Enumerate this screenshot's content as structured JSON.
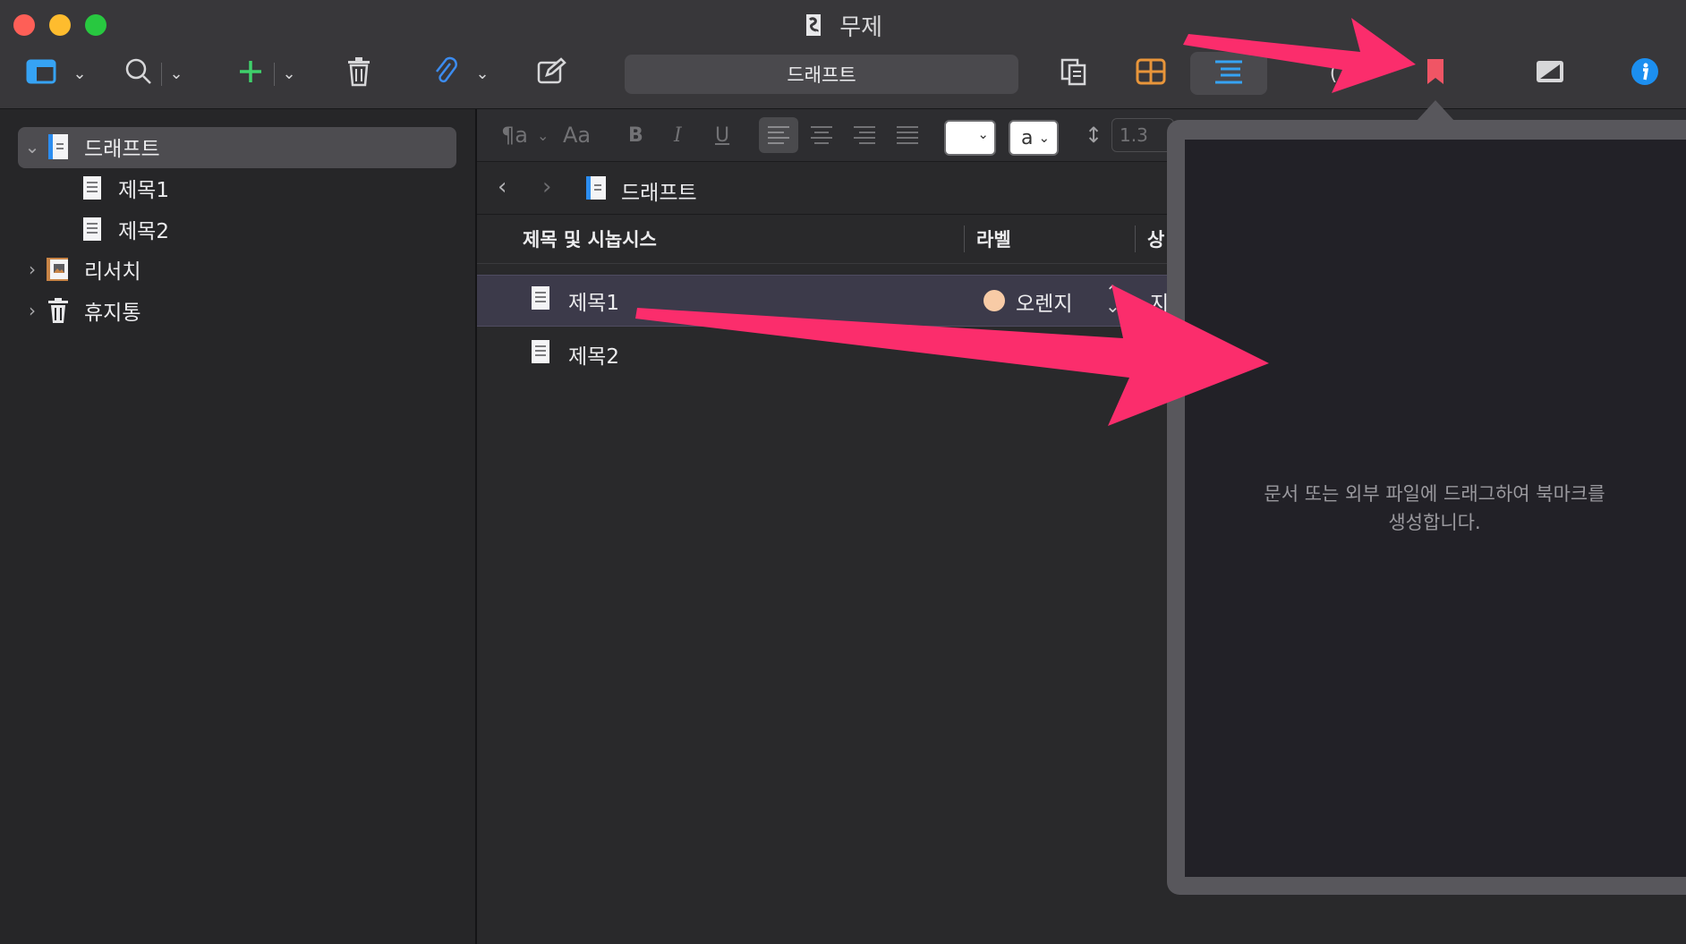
{
  "window": {
    "title": "무제"
  },
  "toolbar": {
    "binder_title": "드래프트",
    "colors": {
      "add": "#3fd16b",
      "attach": "#3c8cf0",
      "corkboard": "#e8953a",
      "outline": "#36a3f4",
      "bookmark": "#f05565",
      "info": "#1c8ff0"
    }
  },
  "binder": {
    "items": [
      {
        "label": "드래프트",
        "expanded": true,
        "icon": "draft-folder-icon"
      },
      {
        "label": "제목1",
        "icon": "document-icon"
      },
      {
        "label": "제목2",
        "icon": "document-icon"
      },
      {
        "label": "리서치",
        "expanded": false,
        "icon": "research-folder-icon"
      },
      {
        "label": "휴지통",
        "expanded": false,
        "icon": "trash-icon"
      }
    ]
  },
  "format_bar": {
    "paragraph_style": "¶a",
    "font": "Aa",
    "bold": "B",
    "italic": "I",
    "underline": "U",
    "text_color_value": "a",
    "line_spacing": "1.3"
  },
  "header_bar": {
    "path": "드래프트"
  },
  "outline": {
    "columns": [
      "제목 및 시놉시스",
      "라벨",
      "상"
    ],
    "rows": [
      {
        "title": "제목1",
        "label": "오렌지",
        "label_color": "#f8cba6",
        "status_partial": "지",
        "selected": true
      },
      {
        "title": "제목2",
        "label": "",
        "selected": false
      }
    ]
  },
  "bookmarks_popover": {
    "empty_message_line1": "문서 또는 외부 파일에 드래그하여 북마크를",
    "empty_message_line2": "생성합니다."
  },
  "annotation": {
    "arrow_color": "#fb2d6c"
  }
}
